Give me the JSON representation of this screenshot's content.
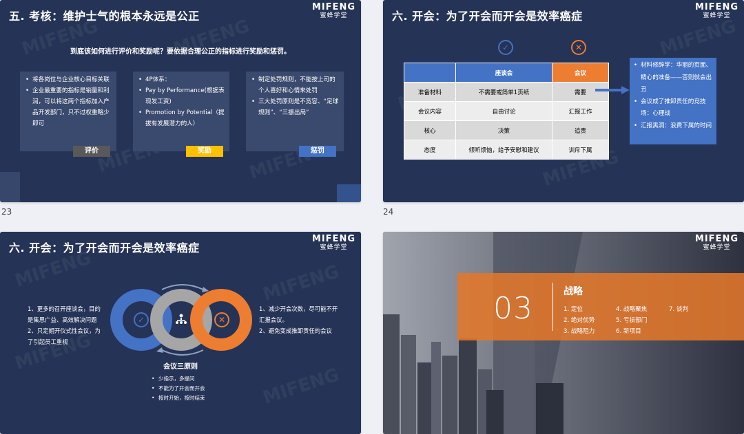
{
  "logo": {
    "en": "MIFENG",
    "zh": "蜜蜂学堂"
  },
  "slide_numbers": [
    "23",
    "24"
  ],
  "slide1": {
    "title": "五. 考核：维护士气的根本永远是公正",
    "lead": "到底该如何进行评价和奖励呢？要依据合理公正的指标进行奖励和惩罚。",
    "boxes": [
      {
        "items": [
          "将各岗位与企业核心目标关联",
          "企业最重要的指标是销量和利润，可以将这两个指标加入产品开发部门，只不过权重略少即可"
        ],
        "tag": "评价",
        "tag_bg": "#595959",
        "tag_color": "#ffffff"
      },
      {
        "items": [
          "4P体系：",
          "Pay by Performance(根据表现发工资)",
          "Promotion by Potential（提拔有发展潜力的人）"
        ],
        "tag": "奖励",
        "tag_bg": "#ffc000",
        "tag_color": "#ffffff"
      },
      {
        "items": [
          "制定处罚规则，不能按上司的个人喜好和心情来处罚",
          "三大处罚原则是不宽容、“足球规则”、“三振出局”"
        ],
        "tag": "惩罚",
        "tag_bg": "#4472c4",
        "tag_color": "#ffffff"
      }
    ]
  },
  "slide2": {
    "title": "六. 开会：为了开会而开会是效率癌症",
    "table": {
      "header": [
        "",
        "座谈会",
        "会议"
      ],
      "rows": [
        [
          "准备材料",
          "不需要或简单1页纸",
          "需要"
        ],
        [
          "会议内容",
          "自由讨论",
          "汇报工作"
        ],
        [
          "核心",
          "决策",
          "追责"
        ],
        [
          "态度",
          "倾听烦恼，给予安慰和建议",
          "训斥下属"
        ]
      ]
    },
    "note": [
      "材料修辞学：华丽的页面、精心的准备——否则就会出丑",
      "会议成了推卸责任的竞技场：心理战",
      "汇报黑洞：浪费下属的时间"
    ],
    "colors": {
      "blue": "#4472c4",
      "orange": "#ed7d31",
      "light": "#d9d9d9",
      "lighter": "#ededed"
    }
  },
  "slide3": {
    "title": "六. 开会：为了开会而开会是效率癌症",
    "left": [
      "1、更多的召开座谈会，目的是集思广益、高效解决问题",
      "2、只定期开仪式性会议，为了引起员工重视"
    ],
    "right": [
      "1、减少开会次数，尽可能不开汇报会议。",
      "2、避免变成推卸责任的会议"
    ],
    "subtitle": "会议三原则",
    "bullets": [
      "少指示，多提问",
      "不能为了开会而开会",
      "按时开始，按时结束"
    ]
  },
  "slide4": {
    "number": "03",
    "title": "战略",
    "items": [
      "1. 定位",
      "2. 绝对优势",
      "3. 战略阻力",
      "4. 战略聚焦",
      "5. 亏损部门",
      "6. 新项目",
      "7. 谈判"
    ]
  }
}
